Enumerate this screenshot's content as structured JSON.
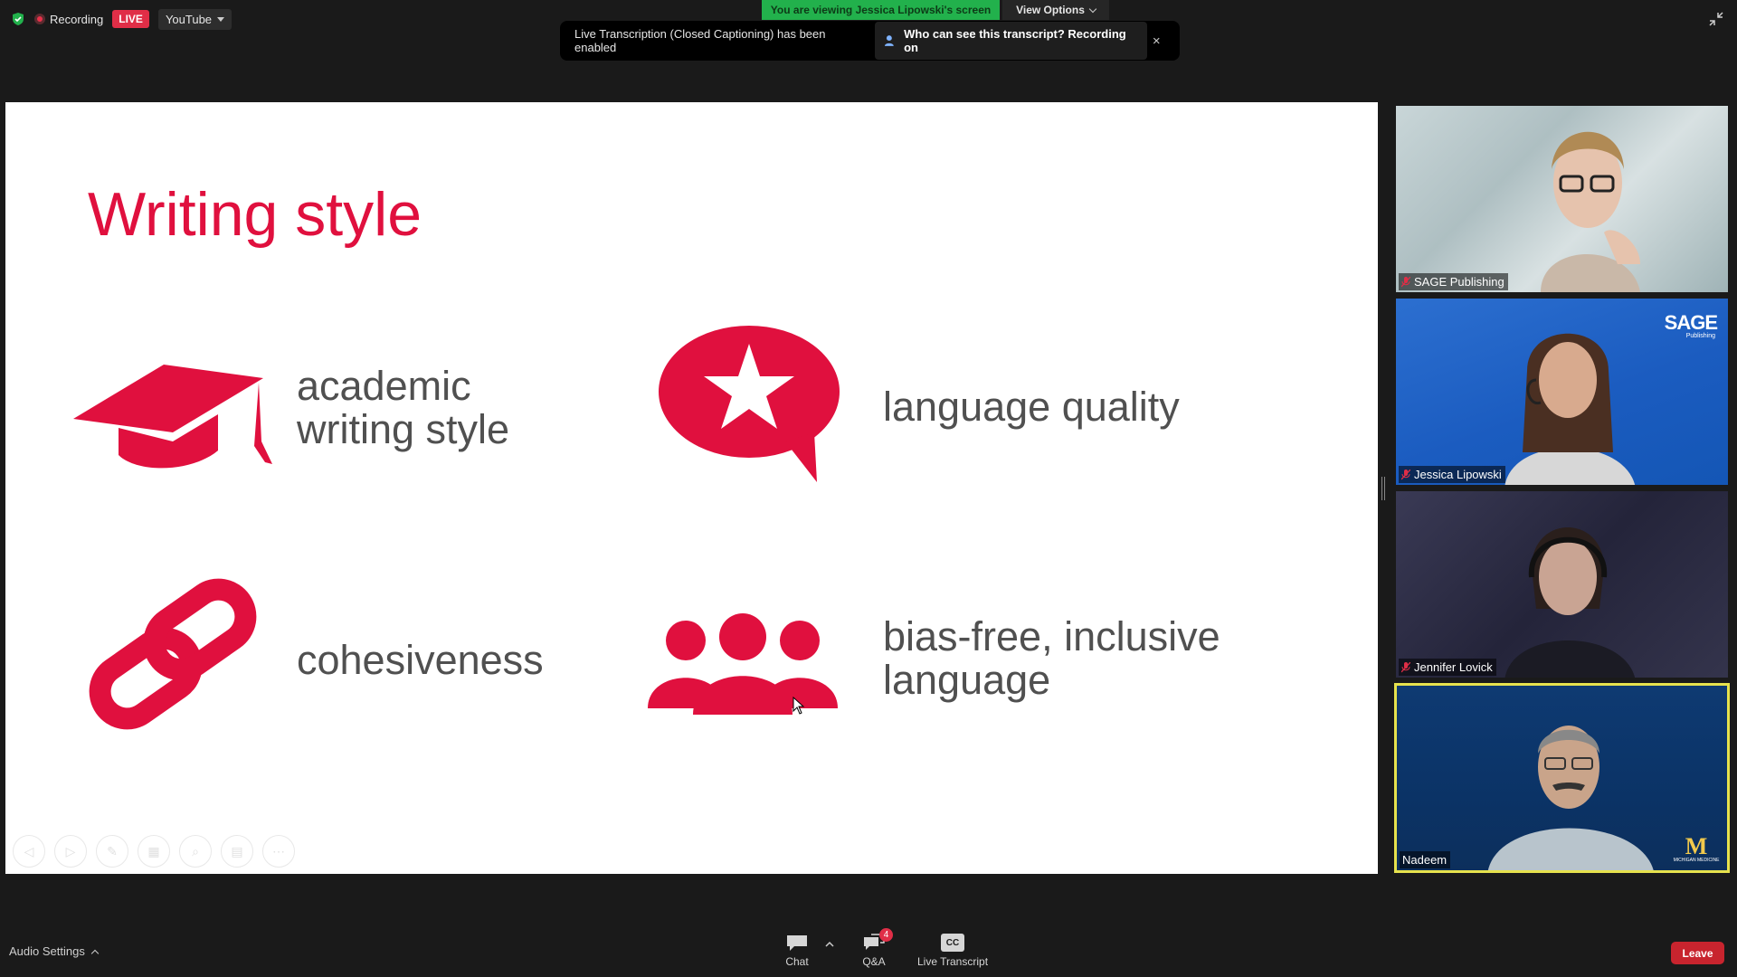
{
  "top": {
    "recording_label": "Recording",
    "live_label": "LIVE",
    "stream_label": "YouTube",
    "viewing_banner": "You are viewing Jessica Lipowski's screen",
    "view_options": "View Options"
  },
  "notification": {
    "message": "Live Transcription (Closed Captioning) has been enabled",
    "who_button": "Who can see this transcript? Recording on",
    "close": "×"
  },
  "slide": {
    "title": "Writing style",
    "features": [
      {
        "line1": "academic",
        "line2": "writing style",
        "icon": "graduation-cap-icon"
      },
      {
        "line1": "language quality",
        "line2": "",
        "icon": "star-speech-bubble-icon"
      },
      {
        "line1": "cohesiveness",
        "line2": "",
        "icon": "chain-link-icon"
      },
      {
        "line1": "bias-free, inclusive",
        "line2": "language",
        "icon": "people-group-icon"
      }
    ],
    "accent_color": "#e0103e",
    "text_color": "#505050"
  },
  "participants": [
    {
      "name": "SAGE Publishing",
      "muted": true
    },
    {
      "name": "Jessica Lipowski",
      "muted": true,
      "logo": "SAGE",
      "logo_sub": "Publishing"
    },
    {
      "name": "Jennifer Lovick",
      "muted": true
    },
    {
      "name": "Nadeem",
      "muted": false,
      "active_speaker": true,
      "logo": "M",
      "logo_sub": "MICHIGAN MEDICINE"
    }
  ],
  "bottom": {
    "audio_settings": "Audio Settings",
    "chat": "Chat",
    "qa": "Q&A",
    "qa_badge": "4",
    "live_transcript": "Live Transcript",
    "cc_icon_text": "CC",
    "leave": "Leave"
  }
}
